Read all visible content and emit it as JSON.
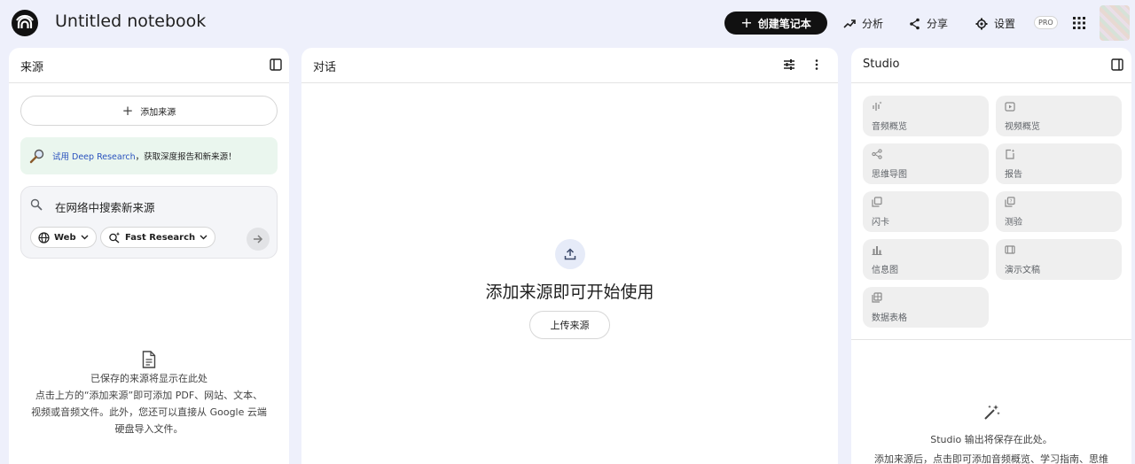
{
  "topbar": {
    "title": "Untitled notebook",
    "create_label": "创建笔记本",
    "analytics_label": "分析",
    "share_label": "分享",
    "settings_label": "设置",
    "pro_badge": "PRO"
  },
  "sources": {
    "title": "来源",
    "add_label": "添加来源",
    "deep_link": "试用 Deep Research",
    "deep_rest": "，获取深度报告和新来源！",
    "search_placeholder": "在网络中搜索新来源",
    "chip_web": "Web",
    "chip_research": "Fast Research",
    "empty_title": "已保存的来源将显示在此处",
    "empty_line1": "点击上方的“添加来源”即可添加 PDF、网站、文本、",
    "empty_line2": "视频或音频文件。此外，您还可以直接从 Google 云端",
    "empty_line3": "硬盘导入文件。"
  },
  "chat": {
    "title": "对话",
    "empty_title": "添加来源即可开始使用",
    "upload_label": "上传来源"
  },
  "studio": {
    "title": "Studio",
    "tiles": [
      "音频概览",
      "视频概览",
      "思维导图",
      "报告",
      "闪卡",
      "测验",
      "信息图",
      "演示文稿",
      "数据表格"
    ],
    "empty_title": "Studio 输出将保存在此处。",
    "empty_sub": "添加来源后，点击即可添加音频概览、学习指南、思维"
  },
  "colors": {
    "background": "#eef0fb",
    "primary_button": "#111111",
    "deep_research_bg": "#eaf6ee",
    "link_blue": "#2a52be"
  }
}
